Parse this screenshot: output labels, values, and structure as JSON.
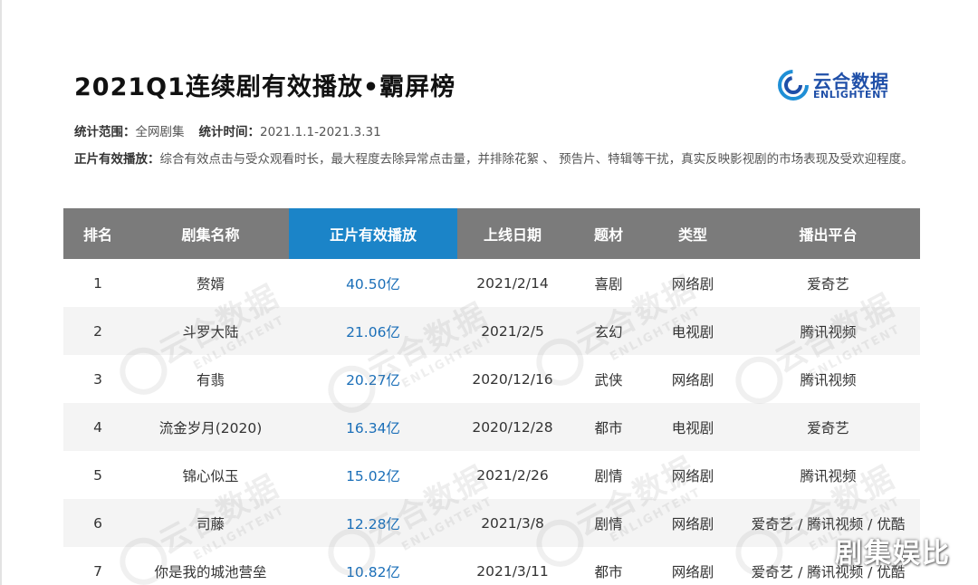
{
  "title": "2021Q1连续剧有效播放•霸屏榜",
  "logo": {
    "cn": "云合数据",
    "en": "ENLIGHTENT",
    "color": "#1f4fa8"
  },
  "meta": {
    "scope_label": "统计范围：",
    "scope_value": "全网剧集",
    "time_label": "统计时间：",
    "time_value": "2021.1.1-2021.3.31"
  },
  "definition": {
    "label": "正片有效播放：",
    "text": "综合有效点击与受众观看时长，最大程度去除异常点击量，并排除花絮 、 预告片、特辑等干扰，真实反映影视剧的市场表现及受欢迎程度。"
  },
  "table": {
    "header_color": "#7b7b7b",
    "highlight_color": "#1b84c8",
    "headers": [
      "排名",
      "剧集名称",
      "正片有效播放",
      "上线日期",
      "题材",
      "类型",
      "播出平台"
    ],
    "rows": [
      {
        "rank": "1",
        "name": "赘婿",
        "plays": "40.50亿",
        "date": "2021/2/14",
        "genre": "喜剧",
        "type": "网络剧",
        "platform": "爱奇艺"
      },
      {
        "rank": "2",
        "name": "斗罗大陆",
        "plays": "21.06亿",
        "date": "2021/2/5",
        "genre": "玄幻",
        "type": "电视剧",
        "platform": "腾讯视频"
      },
      {
        "rank": "3",
        "name": "有翡",
        "plays": "20.27亿",
        "date": "2020/12/16",
        "genre": "武侠",
        "type": "网络剧",
        "platform": "腾讯视频"
      },
      {
        "rank": "4",
        "name": "流金岁月(2020)",
        "plays": "16.34亿",
        "date": "2020/12/28",
        "genre": "都市",
        "type": "电视剧",
        "platform": "爱奇艺"
      },
      {
        "rank": "5",
        "name": "锦心似玉",
        "plays": "15.02亿",
        "date": "2021/2/26",
        "genre": "剧情",
        "type": "网络剧",
        "platform": "腾讯视频"
      },
      {
        "rank": "6",
        "name": "司藤",
        "plays": "12.28亿",
        "date": "2021/3/8",
        "genre": "剧情",
        "type": "网络剧",
        "platform": "爱奇艺 / 腾讯视频 / 优酷"
      },
      {
        "rank": "7",
        "name": "你是我的城池营垒",
        "plays": "10.82亿",
        "date": "2021/3/11",
        "genre": "都市",
        "type": "网络剧",
        "platform": "爱奇艺 / 腾讯视频 / 优酷"
      }
    ]
  },
  "watermark": {
    "cn": "云合数据",
    "en": "ENLIGHTENT"
  },
  "corner_mark": "剧集娱比"
}
